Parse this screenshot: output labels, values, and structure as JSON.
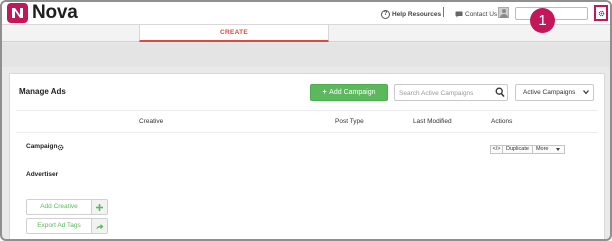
{
  "app": {
    "name": "Nova"
  },
  "header": {
    "help_label": "Help Resources",
    "help_icon_glyph": "?",
    "contact_label": "Contact Us",
    "callout_number": "1"
  },
  "tabs": {
    "create_label": "CREATE"
  },
  "manage": {
    "title": "Manage Ads",
    "add_campaign_label": "Add Campaign",
    "search_placeholder": "Search Active Campaigns",
    "filter_value": "Active Campaigns"
  },
  "table": {
    "columns": [
      "Creative",
      "Post Type",
      "Last Modified",
      "Actions"
    ]
  },
  "row": {
    "campaign_label": "Campaign",
    "advertiser_label": "Advertiser",
    "action_code_label": "</>",
    "action_duplicate_label": "Duplicate",
    "action_more_label": "More"
  },
  "buttons": {
    "add_creative_label": "Add Creative",
    "export_tags_label": "Export Ad Tags"
  },
  "colors": {
    "brand": "#c2185b",
    "accent_orange": "#d84a3c",
    "success_green": "#5cb85c"
  }
}
